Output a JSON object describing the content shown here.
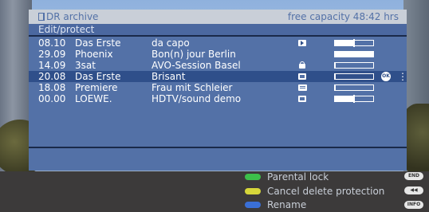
{
  "header": {
    "title": "DR archive",
    "capacity": "free capacity 48:42 hrs",
    "subtitle": "Edit/protect"
  },
  "recordings": [
    {
      "date": "08.10",
      "channel": "Das Erste",
      "title": "da capo",
      "icon": "play-icon",
      "progress": 0.5,
      "selected": false
    },
    {
      "date": "29.09",
      "channel": "Phoenix",
      "title": "Bon(n) jour Berlin",
      "icon": "none",
      "progress": 1.0,
      "selected": false
    },
    {
      "date": "14.09",
      "channel": "3sat",
      "title": "AVO-Session Basel",
      "icon": "lock-icon",
      "progress": 0.02,
      "selected": false
    },
    {
      "date": "20.08",
      "channel": "Das Erste",
      "title": "Brisant",
      "icon": "recording-icon",
      "progress": 0.02,
      "selected": true
    },
    {
      "date": "18.08",
      "channel": "Premiere",
      "title": "Frau mit Schleier",
      "icon": "tag-icon",
      "progress": 0.02,
      "selected": false
    },
    {
      "date": "00.00",
      "channel": "LOEWE.",
      "title": "HDTV/sound demo",
      "icon": "recording-icon",
      "progress": 0.5,
      "selected": false
    }
  ],
  "selected_row_extras": {
    "ok_icon": "OK",
    "more_icon": "⋮"
  },
  "legend": [
    {
      "color": "#3cbf4a",
      "label": "Parental lock"
    },
    {
      "color": "#d6d63a",
      "label": "Cancel delete protection"
    },
    {
      "color": "#3a6fd6",
      "label": "Rename"
    }
  ],
  "keys": [
    {
      "label": "END"
    },
    {
      "label": "◀◀"
    },
    {
      "label": "INFO"
    }
  ]
}
